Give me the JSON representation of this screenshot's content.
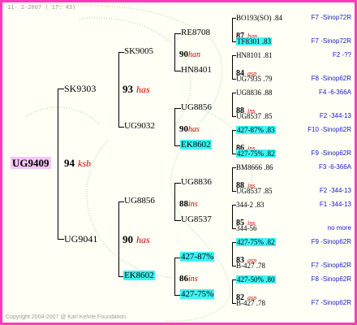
{
  "header": {
    "date": "11-  2-2007 ( 17: 43)"
  },
  "footer": {
    "copyright": "Copyright 2004-2007 @ Karl Kehrle Foundation."
  },
  "root": {
    "id": "UG9409",
    "score": "94",
    "queen": "ksb"
  },
  "gen1": [
    {
      "id": "SK9303",
      "score": "93",
      "queen": "has"
    },
    {
      "id": "UG9041",
      "score": "90",
      "queen": "has"
    }
  ],
  "gen2": [
    {
      "id": "SK9005",
      "score": "90",
      "queen": "han"
    },
    {
      "id": "UG9032",
      "score": "90",
      "queen": "has"
    },
    {
      "id": "UG8856",
      "score": "88",
      "queen": "ins"
    },
    {
      "id": "EK8602",
      "score": "86",
      "queen": "ins"
    }
  ],
  "gen3": [
    {
      "id": "RE8708",
      "score": "87",
      "queen": "han"
    },
    {
      "id": "HN8401",
      "score": "84",
      "queen": "asp"
    },
    {
      "id": "UG8856",
      "score": "88",
      "queen": "ins"
    },
    {
      "id": "EK8602",
      "score": "86",
      "queen": "ins"
    },
    {
      "id": "UG8836",
      "score": "88",
      "queen": "ins"
    },
    {
      "id": "UG8537",
      "score": "85",
      "queen": "ins"
    },
    {
      "id": "427-87%",
      "score": "83",
      "queen": "asp"
    },
    {
      "id": "427-75%",
      "score": "82",
      "queen": "asp"
    }
  ],
  "gen4": [
    {
      "id": "BO193(SO) .84",
      "pedigree": "F7 -Sinop72R"
    },
    {
      "id": "TF8301 .83",
      "pedigree": "F7 -Sinop72R"
    },
    {
      "id": "HN8101 .81",
      "pedigree": "F2 -??"
    },
    {
      "id": "UG7935 .79",
      "pedigree": "F8 -Sinop62R"
    },
    {
      "id": "UG8836 .88",
      "pedigree": "F4 -6-366A"
    },
    {
      "id": "UG8537 .85",
      "pedigree": "F2 -344-13"
    },
    {
      "id": "427-87% .83",
      "pedigree": "F10 -Sinop62R"
    },
    {
      "id": "427-75% .82",
      "pedigree": "F9 -Sinop62R"
    },
    {
      "id": "BM8666 .86",
      "pedigree": "F3 -6-366A"
    },
    {
      "id": "UG8537 .85",
      "pedigree": "F2 -344-13"
    },
    {
      "id": "344-2 .83",
      "pedigree": "F1 -344-13"
    },
    {
      "id": "344-56",
      "pedigree": "no more"
    },
    {
      "id": "427-75% .82",
      "pedigree": "F9 -Sinop62R"
    },
    {
      "id": "B-427 .78",
      "pedigree": "F7 -Sinop62R"
    },
    {
      "id": "427-50% .80",
      "pedigree": "F8 -Sinop62R"
    },
    {
      "id": "B-427 .78",
      "pedigree": "F7 -Sinop62R"
    }
  ],
  "colors": {
    "border": "#ff3bb8",
    "highlight": "#3ef4f4",
    "root_bg": "#f6c6f6",
    "queen_text": "#cc0000",
    "pedigree_text": "#1818c8",
    "watermark": "#c8ecc0"
  }
}
